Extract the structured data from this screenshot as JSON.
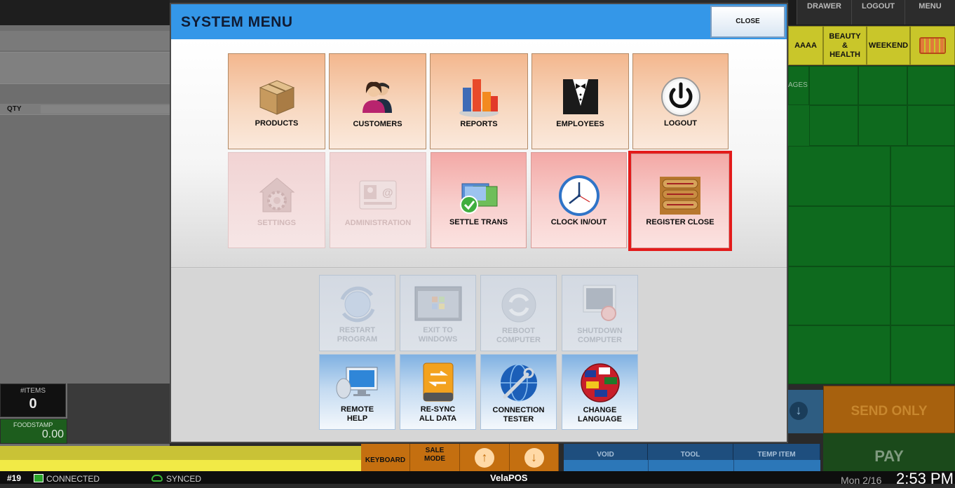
{
  "modal": {
    "title": "SYSTEM MENU",
    "close_label": "CLOSE",
    "main_tiles": [
      {
        "label": "PRODUCTS",
        "icon": "box-icon",
        "state": "enabled"
      },
      {
        "label": "CUSTOMERS",
        "icon": "people-icon",
        "state": "enabled"
      },
      {
        "label": "REPORTS",
        "icon": "bar-chart-icon",
        "state": "enabled"
      },
      {
        "label": "EMPLOYEES",
        "icon": "tuxedo-icon",
        "state": "enabled"
      },
      {
        "label": "LOGOUT",
        "icon": "power-icon",
        "state": "enabled"
      },
      {
        "label": "SETTINGS",
        "icon": "settings-house-icon",
        "state": "disabled"
      },
      {
        "label": "ADMINISTRATION",
        "icon": "admin-card-icon",
        "state": "disabled"
      },
      {
        "label": "SETTLE TRANS",
        "icon": "settle-check-icon",
        "state": "enabled"
      },
      {
        "label": "CLOCK IN/OUT",
        "icon": "clock-icon",
        "state": "enabled"
      },
      {
        "label": "REGISTER CLOSE",
        "icon": "coin-roll-icon",
        "state": "enabled",
        "highlighted": true
      }
    ],
    "system_tiles": [
      {
        "line1": "RESTART",
        "line2": "PROGRAM",
        "icon": "restart-globe-icon",
        "state": "disabled"
      },
      {
        "line1": "EXIT TO",
        "line2": "WINDOWS",
        "icon": "windows-icon",
        "state": "disabled"
      },
      {
        "line1": "REBOOT",
        "line2": "COMPUTER",
        "icon": "reboot-icon",
        "state": "disabled"
      },
      {
        "line1": "SHUTDOWN",
        "line2": "COMPUTER",
        "icon": "shutdown-monitor-icon",
        "state": "disabled"
      },
      {
        "line1": "REMOTE",
        "line2": "HELP",
        "icon": "remote-monitor-icon",
        "state": "enabled"
      },
      {
        "line1": "RE-SYNC",
        "line2": "ALL DATA",
        "icon": "sync-drive-icon",
        "state": "enabled"
      },
      {
        "line1": "CONNECTION",
        "line2": "TESTER",
        "icon": "globe-wrench-icon",
        "state": "enabled"
      },
      {
        "line1": "CHANGE",
        "line2": "LANGUAGE",
        "icon": "flags-globe-icon",
        "state": "enabled"
      }
    ]
  },
  "background": {
    "qty_label": "QTY",
    "items_label": "#ITEMS",
    "items_value": "0",
    "foodstamp_label": "FOODSTAMP",
    "foodstamp_value": "0.00",
    "top_buttons": [
      "DRAWER",
      "LOGOUT",
      "MENU"
    ],
    "categories": [
      "AAAA",
      "BEAUTY & HEALTH",
      "WEEKEND"
    ],
    "ages_fragment": "AGES",
    "send_only": "SEND ONLY",
    "pay": "PAY",
    "keyboard": "KEYBOARD",
    "sale_mode": "SALE MODE",
    "void": "VOID",
    "tool": "TOOL",
    "temp_item": "TEMP ITEM"
  },
  "status_bar": {
    "register": "#19",
    "connection": "CONNECTED",
    "sync": "SYNCED",
    "brand": "VelaPOS",
    "date": "Mon 2/16",
    "time": "2:53 PM"
  },
  "colors": {
    "header_blue": "#3497e8",
    "highlight_red": "#e31b1b",
    "tile_orange": "#f3b78e",
    "tile_pink": "#f3a9a6"
  }
}
